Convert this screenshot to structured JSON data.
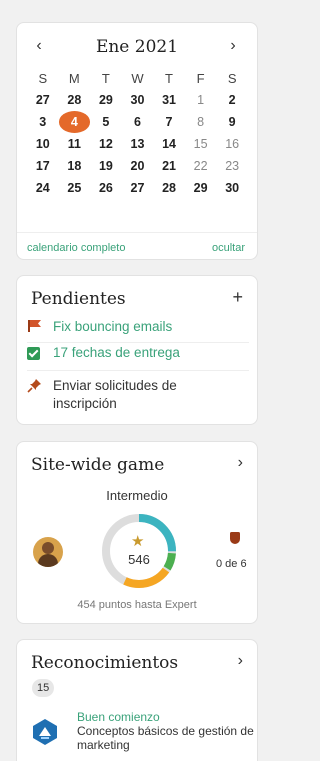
{
  "calendar": {
    "month_label": "Ene 2021",
    "prev_icon": "‹",
    "next_icon": "›",
    "weekdays": [
      "S",
      "M",
      "T",
      "W",
      "T",
      "F",
      "S"
    ],
    "weeks": [
      [
        "27",
        "28",
        "29",
        "30",
        "31",
        "1",
        "2"
      ],
      [
        "3",
        "4",
        "5",
        "6",
        "7",
        "8",
        "9"
      ],
      [
        "10",
        "11",
        "12",
        "13",
        "14",
        "15",
        "16"
      ],
      [
        "17",
        "18",
        "19",
        "20",
        "21",
        "22",
        "23"
      ],
      [
        "24",
        "25",
        "26",
        "27",
        "28",
        "29",
        "30"
      ]
    ],
    "today": "4",
    "full_calendar_link": "calendario completo",
    "hide_link": "ocultar",
    "accent_color": "#e4692a"
  },
  "pending": {
    "title": "Pendientes",
    "add_icon": "+",
    "tasks": [
      {
        "icon": "flag-icon",
        "label": "Fix bouncing emails"
      },
      {
        "icon": "checkbox-icon",
        "label": "17 fechas de entrega"
      },
      {
        "icon": "pin-icon",
        "label": "Enviar solicitudes de inscripción"
      }
    ],
    "link_color": "#3aa27a"
  },
  "game": {
    "title": "Site-wide game",
    "chevron": "›",
    "level": "Intermedio",
    "score": "546",
    "badges": "0 de 6",
    "points_to_next": "454 puntos hasta Expert",
    "ring_colors": [
      "#3cb4c0",
      "#4caf50",
      "#f5a623",
      "#dddddd"
    ]
  },
  "recognitions": {
    "title": "Reconocimientos",
    "chevron": "›",
    "count": "15",
    "achievement": {
      "title": "Buen comienzo",
      "description": "Conceptos básicos de gestión de marketing"
    }
  }
}
